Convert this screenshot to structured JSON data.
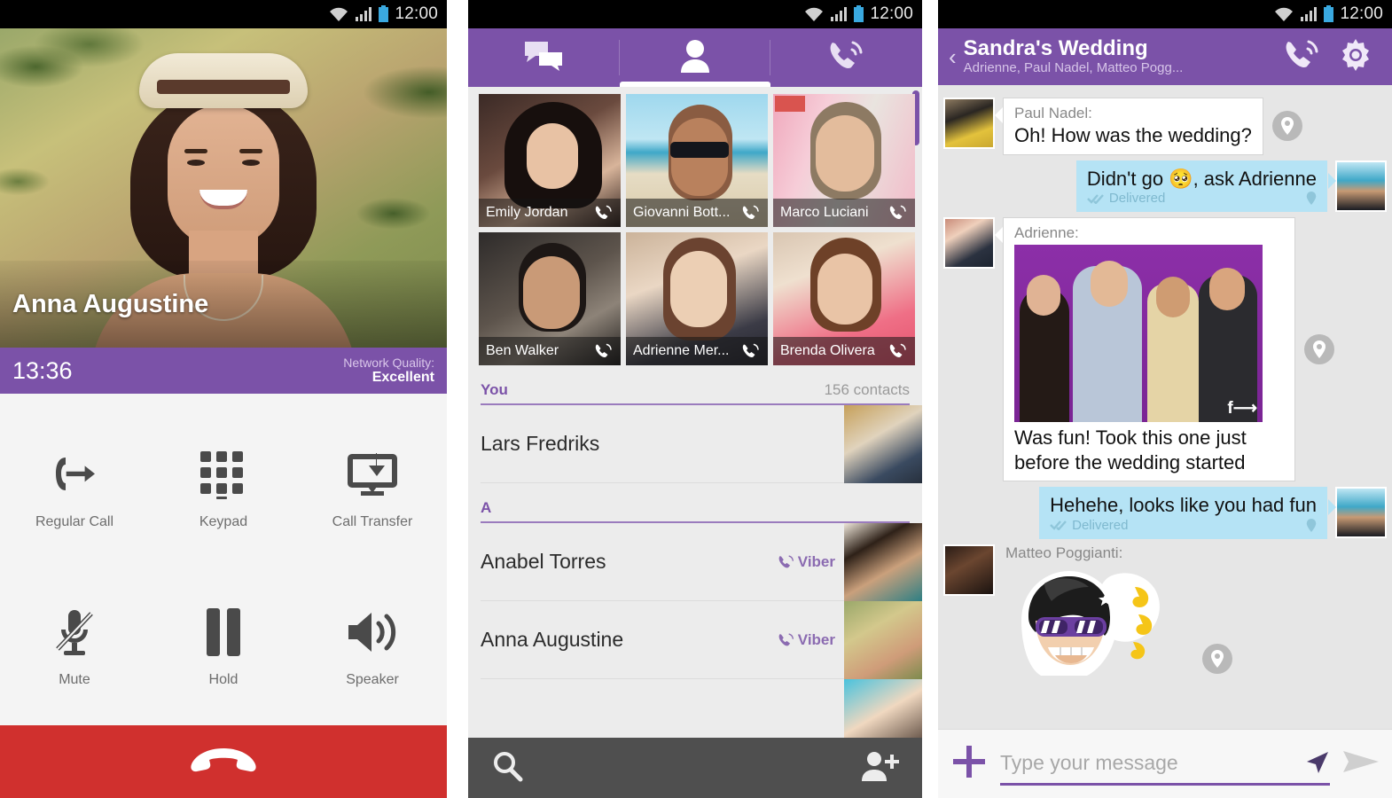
{
  "statusbar": {
    "time": "12:00",
    "icons": [
      "wifi-icon",
      "signal-icon",
      "battery-icon"
    ]
  },
  "colors": {
    "brand_purple": "#7b52a8",
    "end_call_red": "#d0302e",
    "outgoing_bubble": "#b5e3f5",
    "bottom_bar_gray": "#4f4f4f"
  },
  "call_screen": {
    "contact_name": "Anna Augustine",
    "duration": "13:36",
    "network_quality_label": "Network Quality:",
    "network_quality_value": "Excellent",
    "controls": [
      {
        "label": "Regular Call",
        "icon": "phone-transfer-icon"
      },
      {
        "label": "Keypad",
        "icon": "dialpad-icon"
      },
      {
        "label": "Call Transfer",
        "icon": "screen-transfer-icon"
      },
      {
        "label": "Mute",
        "icon": "microphone-muted-icon"
      },
      {
        "label": "Hold",
        "icon": "pause-icon"
      },
      {
        "label": "Speaker",
        "icon": "speaker-icon"
      }
    ],
    "end_call_icon": "hangup-icon"
  },
  "contacts_screen": {
    "tabs": [
      {
        "name": "messages",
        "icon": "chat-bubbles-icon",
        "active": false
      },
      {
        "name": "contacts",
        "icon": "person-icon",
        "active": true
      },
      {
        "name": "calls",
        "icon": "viber-phone-icon",
        "active": false
      }
    ],
    "favorites": [
      {
        "name": "Emily Jordan",
        "call_icon": "viber-phone-icon"
      },
      {
        "name": "Giovanni Bott...",
        "call_icon": "viber-phone-icon"
      },
      {
        "name": "Marco Luciani",
        "call_icon": "viber-phone-icon"
      },
      {
        "name": "Ben Walker",
        "call_icon": "viber-phone-icon"
      },
      {
        "name": "Adrienne Mer...",
        "call_icon": "viber-phone-icon"
      },
      {
        "name": "Brenda Olivera",
        "call_icon": "viber-phone-icon"
      }
    ],
    "sections": [
      {
        "title": "You",
        "count_label": "156 contacts"
      },
      {
        "title": "A",
        "count_label": ""
      }
    ],
    "rows": [
      {
        "name": "Lars Fredriks",
        "badge": ""
      },
      {
        "name": "Anabel Torres",
        "badge": "Viber"
      },
      {
        "name": "Anna Augustine",
        "badge": "Viber"
      }
    ],
    "bottom_bar": {
      "search_icon": "search-icon",
      "add_contact_icon": "add-contact-icon"
    }
  },
  "chat_screen": {
    "title": "Sandra's Wedding",
    "subtitle": "Adrienne, Paul Nadel, Matteo Pogg...",
    "back_icon": "back-chevron-icon",
    "call_icon": "viber-phone-icon",
    "settings_icon": "gear-icon",
    "messages": [
      {
        "direction": "in",
        "sender": "Paul Nadel:",
        "text": "Oh! How was the wedding?",
        "status": "",
        "type": "text"
      },
      {
        "direction": "out",
        "sender": "",
        "text": "Didn't go 🥺, ask Adrienne",
        "status": "Delivered",
        "type": "text"
      },
      {
        "direction": "in",
        "sender": "Adrienne:",
        "text": "Was fun! Took this one just before the wedding started",
        "status": "",
        "type": "photo"
      },
      {
        "direction": "out",
        "sender": "",
        "text": "Hehehe, looks like you had fun",
        "status": "Delivered",
        "type": "text"
      },
      {
        "direction": "in",
        "sender": "Matteo Poggianti:",
        "text": "",
        "status": "",
        "type": "sticker"
      }
    ],
    "composer": {
      "add_icon": "plus-icon",
      "placeholder": "Type your message",
      "location_icon": "send-location-icon",
      "send_icon": "send-icon"
    }
  }
}
